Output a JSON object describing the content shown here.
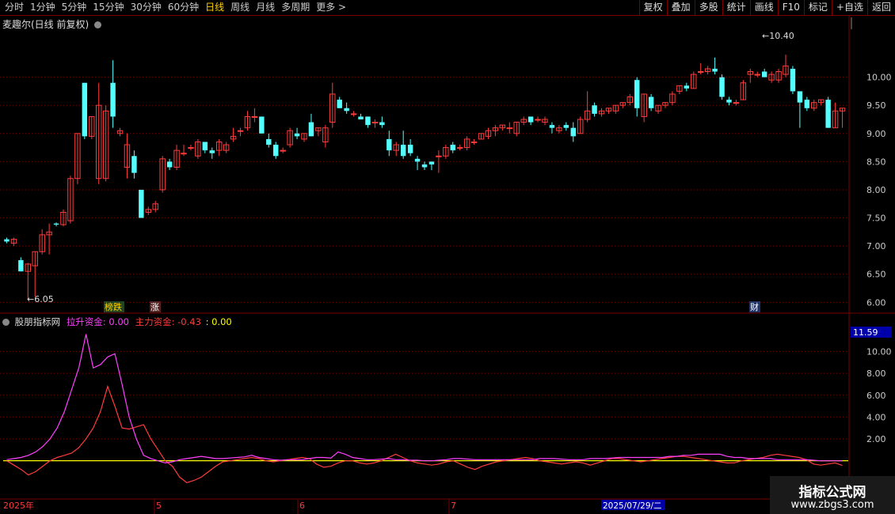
{
  "toolbar": {
    "periods": [
      "分时",
      "1分钟",
      "5分钟",
      "15分钟",
      "30分钟",
      "60分钟",
      "日线",
      "周线",
      "月线",
      "多周期",
      "更多 >"
    ],
    "active": "日线",
    "right_buttons": [
      "复权",
      "叠加",
      "多股",
      "统计",
      "画线",
      "F10",
      "标记",
      "+自选",
      "返回"
    ]
  },
  "main_title": "麦趣尔(日线 前复权)",
  "price_axis": [
    "10.00",
    "9.50",
    "9.00",
    "8.50",
    "8.00",
    "7.50",
    "7.00",
    "6.50",
    "6.00"
  ],
  "high_label": "10.40",
  "low_label": "6.05",
  "markers": {
    "bang": "榜跌",
    "zhang": "涨",
    "cai": "财"
  },
  "indicator": {
    "name": "股朋指标网",
    "s1_label": "拉升资金: 0.00",
    "s2_label": "主力资金: -0.43",
    "s3_label": ": 0.00",
    "axis": [
      "10.00",
      "8.00",
      "6.00",
      "4.00",
      "2.00"
    ],
    "current": "11.59"
  },
  "date_axis": {
    "year": "2025年",
    "m5": "5",
    "m6": "6",
    "m7": "7",
    "cursor": "2025/07/29/二"
  },
  "watermark": {
    "line1": "指标公式网",
    "line2": "www.zbgs3.com"
  },
  "colors": {
    "up": "#ff3c3c",
    "down": "#54ffff",
    "magenta": "#ff40ff",
    "yellow": "#ffff00",
    "grid": "#7a0000"
  },
  "chart_data": {
    "type": "candlestick",
    "ohlc": [
      [
        7.12,
        7.15,
        7.05,
        7.08
      ],
      [
        7.05,
        7.15,
        7.0,
        7.12
      ],
      [
        6.75,
        6.8,
        6.55,
        6.55
      ],
      [
        6.55,
        6.7,
        6.05,
        6.68
      ],
      [
        6.65,
        6.9,
        6.1,
        6.9
      ],
      [
        6.9,
        7.3,
        6.85,
        7.2
      ],
      [
        7.2,
        7.4,
        6.85,
        7.25
      ],
      [
        7.4,
        7.42,
        7.35,
        7.38
      ],
      [
        7.38,
        7.65,
        7.35,
        7.6
      ],
      [
        7.45,
        8.25,
        7.4,
        8.2
      ],
      [
        8.2,
        9.0,
        8.1,
        9.0
      ],
      [
        9.9,
        9.9,
        8.9,
        8.95
      ],
      [
        8.95,
        9.3,
        8.9,
        9.3
      ],
      [
        8.2,
        9.9,
        8.1,
        9.5
      ],
      [
        8.2,
        9.5,
        8.15,
        9.4
      ],
      [
        9.9,
        10.3,
        9.1,
        9.3
      ],
      [
        9.0,
        9.1,
        8.95,
        9.05
      ],
      [
        8.4,
        9.0,
        8.2,
        8.8
      ],
      [
        8.6,
        8.7,
        8.2,
        8.3
      ],
      [
        8.0,
        8.0,
        7.5,
        7.5
      ],
      [
        7.6,
        7.7,
        7.55,
        7.65
      ],
      [
        7.65,
        7.8,
        7.6,
        7.75
      ],
      [
        8.0,
        8.6,
        7.95,
        8.55
      ],
      [
        8.5,
        8.55,
        8.35,
        8.4
      ],
      [
        8.4,
        8.8,
        8.35,
        8.7
      ],
      [
        8.65,
        8.8,
        8.6,
        8.65
      ],
      [
        8.75,
        8.8,
        8.7,
        8.75
      ],
      [
        8.6,
        8.9,
        8.55,
        8.85
      ],
      [
        8.85,
        8.85,
        8.65,
        8.7
      ],
      [
        8.7,
        8.75,
        8.55,
        8.65
      ],
      [
        8.7,
        8.9,
        8.6,
        8.85
      ],
      [
        8.7,
        8.85,
        8.65,
        8.8
      ],
      [
        8.9,
        9.1,
        8.85,
        8.95
      ],
      [
        9.05,
        9.1,
        8.95,
        9.05
      ],
      [
        9.1,
        9.4,
        9.05,
        9.3
      ],
      [
        9.3,
        9.45,
        9.2,
        9.3
      ],
      [
        9.3,
        9.3,
        9.0,
        9.0
      ],
      [
        8.9,
        9.0,
        8.75,
        8.8
      ],
      [
        8.8,
        8.85,
        8.55,
        8.6
      ],
      [
        8.7,
        8.75,
        8.65,
        8.7
      ],
      [
        8.8,
        9.1,
        8.75,
        9.05
      ],
      [
        9.0,
        9.1,
        8.9,
        8.95
      ],
      [
        8.9,
        9.0,
        8.85,
        9.0
      ],
      [
        9.2,
        9.35,
        8.95,
        8.95
      ],
      [
        9.05,
        9.1,
        8.95,
        9.1
      ],
      [
        8.85,
        9.15,
        8.75,
        9.1
      ],
      [
        9.2,
        9.9,
        9.1,
        9.7
      ],
      [
        9.6,
        9.65,
        9.45,
        9.45
      ],
      [
        9.45,
        9.55,
        9.35,
        9.4
      ],
      [
        9.35,
        9.4,
        9.3,
        9.35
      ],
      [
        9.3,
        9.35,
        9.25,
        9.25
      ],
      [
        9.3,
        9.3,
        9.1,
        9.15
      ],
      [
        9.2,
        9.25,
        9.1,
        9.2
      ],
      [
        9.2,
        9.3,
        9.1,
        9.15
      ],
      [
        8.9,
        9.05,
        8.6,
        8.7
      ],
      [
        8.7,
        8.85,
        8.6,
        8.8
      ],
      [
        8.8,
        9.05,
        8.55,
        8.6
      ],
      [
        8.8,
        8.9,
        8.6,
        8.65
      ],
      [
        8.55,
        8.6,
        8.35,
        8.5
      ],
      [
        8.45,
        8.5,
        8.35,
        8.4
      ],
      [
        8.5,
        8.5,
        8.35,
        8.45
      ],
      [
        8.6,
        8.7,
        8.3,
        8.6
      ],
      [
        8.6,
        8.8,
        8.55,
        8.75
      ],
      [
        8.8,
        8.85,
        8.65,
        8.7
      ],
      [
        8.75,
        8.8,
        8.7,
        8.75
      ],
      [
        8.75,
        8.95,
        8.7,
        8.9
      ],
      [
        8.85,
        8.9,
        8.8,
        8.85
      ],
      [
        8.9,
        9.0,
        8.9,
        9.0
      ],
      [
        8.95,
        9.1,
        8.9,
        9.05
      ],
      [
        9.05,
        9.15,
        8.95,
        9.1
      ],
      [
        9.1,
        9.15,
        9.05,
        9.15
      ],
      [
        9.1,
        9.2,
        9.0,
        9.1
      ],
      [
        9.0,
        9.2,
        8.95,
        9.2
      ],
      [
        9.2,
        9.3,
        9.15,
        9.25
      ],
      [
        9.3,
        9.3,
        9.15,
        9.2
      ],
      [
        9.25,
        9.3,
        9.2,
        9.25
      ],
      [
        9.2,
        9.3,
        9.15,
        9.25
      ],
      [
        9.15,
        9.2,
        9.0,
        9.1
      ],
      [
        9.05,
        9.15,
        9.0,
        9.1
      ],
      [
        9.15,
        9.2,
        9.05,
        9.1
      ],
      [
        9.1,
        9.2,
        8.85,
        8.95
      ],
      [
        9.0,
        9.3,
        9.0,
        9.25
      ],
      [
        9.25,
        9.75,
        9.2,
        9.4
      ],
      [
        9.5,
        9.55,
        9.3,
        9.35
      ],
      [
        9.35,
        9.45,
        9.3,
        9.4
      ],
      [
        9.4,
        9.45,
        9.35,
        9.45
      ],
      [
        9.4,
        9.5,
        9.35,
        9.5
      ],
      [
        9.5,
        9.55,
        9.45,
        9.55
      ],
      [
        9.55,
        9.7,
        9.5,
        9.65
      ],
      [
        9.95,
        10.0,
        9.3,
        9.45
      ],
      [
        9.3,
        9.7,
        9.2,
        9.7
      ],
      [
        9.65,
        9.7,
        9.4,
        9.45
      ],
      [
        9.4,
        9.5,
        9.35,
        9.5
      ],
      [
        9.5,
        9.55,
        9.45,
        9.55
      ],
      [
        9.55,
        9.75,
        9.5,
        9.7
      ],
      [
        9.75,
        9.85,
        9.7,
        9.85
      ],
      [
        9.85,
        9.9,
        9.75,
        9.8
      ],
      [
        9.8,
        10.1,
        9.8,
        10.05
      ],
      [
        10.1,
        10.25,
        10.05,
        10.1
      ],
      [
        10.1,
        10.2,
        10.05,
        10.15
      ],
      [
        10.15,
        10.35,
        10.05,
        10.1
      ],
      [
        10.0,
        10.05,
        9.6,
        9.65
      ],
      [
        9.6,
        9.65,
        9.5,
        9.55
      ],
      [
        9.55,
        9.6,
        9.5,
        9.55
      ],
      [
        9.6,
        9.95,
        9.6,
        9.9
      ],
      [
        10.05,
        10.15,
        9.9,
        10.1
      ],
      [
        10.05,
        10.1,
        10.0,
        10.05
      ],
      [
        10.1,
        10.15,
        10.0,
        10.0
      ],
      [
        9.95,
        10.1,
        9.9,
        10.05
      ],
      [
        9.95,
        10.15,
        9.9,
        10.1
      ],
      [
        10.05,
        10.4,
        10.0,
        10.2
      ],
      [
        10.15,
        10.2,
        9.7,
        9.75
      ],
      [
        9.75,
        9.75,
        9.1,
        9.55
      ],
      [
        9.6,
        9.65,
        9.4,
        9.45
      ],
      [
        9.45,
        9.6,
        9.4,
        9.55
      ],
      [
        9.55,
        9.6,
        9.5,
        9.6
      ],
      [
        9.6,
        9.65,
        9.1,
        9.1
      ],
      [
        9.1,
        9.55,
        9.1,
        9.4
      ],
      [
        9.4,
        9.45,
        9.1,
        9.45
      ]
    ],
    "indicator": {
      "magenta": [
        0.1,
        0.2,
        0.3,
        0.5,
        0.8,
        1.3,
        2.0,
        3.0,
        4.5,
        6.5,
        8.5,
        11.59,
        8.5,
        8.8,
        9.5,
        9.8,
        7.0,
        4.0,
        2.0,
        0.5,
        0.2,
        0,
        -0.2,
        -0.1,
        0.1,
        0.2,
        0.3,
        0.4,
        0.3,
        0.2,
        0.2,
        0.25,
        0.3,
        0.35,
        0.5,
        0.3,
        0.2,
        0.1,
        0.05,
        0.1,
        0.1,
        0.1,
        0.2,
        0.3,
        0.3,
        0.25,
        0.8,
        0.6,
        0.3,
        0.2,
        0.1,
        0.1,
        0.15,
        0.2,
        0.1,
        0.1,
        0.05,
        0.05,
        0,
        0,
        0.05,
        0.1,
        0.2,
        0.2,
        0.15,
        0.1,
        0.1,
        0.1,
        0.1,
        0.1,
        0.1,
        0.1,
        0.1,
        0.1,
        0.2,
        0.2,
        0.2,
        0.15,
        0.1,
        0.1,
        0.1,
        0.2,
        0.2,
        0.2,
        0.25,
        0.3,
        0.3,
        0.3,
        0.3,
        0.3,
        0.3,
        0.3,
        0.4,
        0.4,
        0.5,
        0.5,
        0.6,
        0.6,
        0.6,
        0.6,
        0.4,
        0.3,
        0.3,
        0.2,
        0.2,
        0.2,
        0.2,
        0.1,
        0.1,
        0.1,
        0.1,
        0.1,
        0.05,
        0,
        0,
        0,
        0
      ],
      "red": [
        0,
        -0.4,
        -0.8,
        -1.3,
        -1.0,
        -0.5,
        0,
        0.3,
        0.5,
        0.7,
        1.2,
        2.0,
        3.0,
        4.5,
        6.8,
        5.0,
        3.0,
        2.9,
        3.1,
        3.3,
        2.0,
        1.0,
        0,
        -0.5,
        -1.5,
        -2.0,
        -1.8,
        -1.5,
        -1.0,
        -0.5,
        -0.1,
        0,
        0.1,
        0.2,
        0.3,
        0.2,
        0,
        -0.1,
        0,
        0.1,
        0.2,
        0.3,
        0.2,
        -0.3,
        -0.6,
        -0.5,
        -0.2,
        0,
        0,
        -0.2,
        -0.3,
        -0.2,
        0,
        0.3,
        0.6,
        0.3,
        0,
        -0.2,
        -0.3,
        -0.4,
        -0.3,
        -0.1,
        0,
        -0.3,
        -0.6,
        -0.8,
        -0.5,
        -0.3,
        -0.1,
        0,
        0.1,
        0.2,
        0.3,
        0.2,
        0,
        -0.1,
        -0.2,
        -0.3,
        -0.2,
        -0.1,
        -0.2,
        -0.4,
        -0.2,
        0,
        0.2,
        0.2,
        0.1,
        0,
        -0.1,
        0,
        0.1,
        0.2,
        0.3,
        0.4,
        0.4,
        0.3,
        0.2,
        0.1,
        0,
        -0.1,
        -0.2,
        -0.2,
        0,
        0.1,
        0.2,
        0.3,
        0.5,
        0.6,
        0.5,
        0.4,
        0.3,
        0.1,
        -0.3,
        -0.4,
        -0.3,
        -0.2,
        -0.43
      ]
    },
    "price_range": [
      5.85,
      10.95
    ],
    "indicator_range": [
      -3.5,
      12.5
    ]
  }
}
